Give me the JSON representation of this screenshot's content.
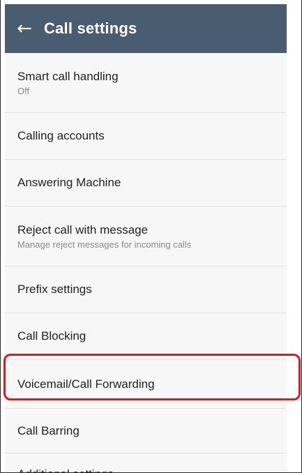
{
  "header": {
    "title": "Call settings",
    "back_icon": "arrow-back-icon"
  },
  "settings": {
    "items": [
      {
        "label": "Smart call handling",
        "subtitle": "Off"
      },
      {
        "label": "Calling accounts"
      },
      {
        "label": "Answering Machine"
      },
      {
        "label": "Reject call with message",
        "subtitle": "Manage reject messages for incoming calls"
      },
      {
        "label": "Prefix settings"
      },
      {
        "label": "Call Blocking"
      },
      {
        "label": "Voicemail/Call Forwarding"
      },
      {
        "label": "Call Barring"
      },
      {
        "label": "Additional settings"
      }
    ]
  },
  "colors": {
    "appbar": "#4a5d70",
    "highlight": "#e8141c"
  }
}
